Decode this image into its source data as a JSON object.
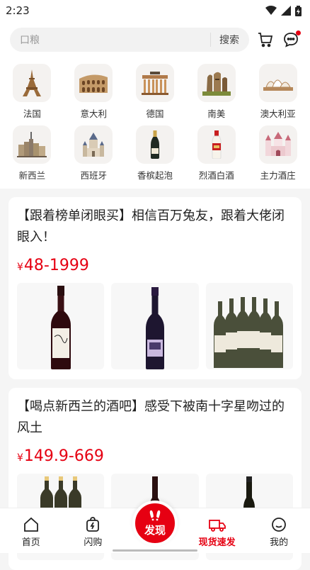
{
  "status": {
    "time": "2:23"
  },
  "search": {
    "placeholder": "口粮",
    "button": "搜索"
  },
  "categories": [
    {
      "label": "法国",
      "icon": "eiffel-tower-icon"
    },
    {
      "label": "意大利",
      "icon": "colosseum-icon"
    },
    {
      "label": "德国",
      "icon": "brandenburg-gate-icon"
    },
    {
      "label": "南美",
      "icon": "moai-icon"
    },
    {
      "label": "澳大利亚",
      "icon": "opera-house-icon"
    },
    {
      "label": "新西兰",
      "icon": "city-skyline-icon"
    },
    {
      "label": "西班牙",
      "icon": "cathedral-icon"
    },
    {
      "label": "香槟起泡",
      "icon": "champagne-bottle-icon"
    },
    {
      "label": "烈酒白酒",
      "icon": "baijiu-bottle-icon"
    },
    {
      "label": "主力酒庄",
      "icon": "castle-icon"
    }
  ],
  "cards": [
    {
      "title": "【跟着榜单闭眼买】相信百万兔友，跟着大佬闭眼入！",
      "currency": "¥",
      "price": "48-1999"
    },
    {
      "title": "【喝点新西兰的酒吧】感受下被南十字星吻过的风土",
      "currency": "¥",
      "price": "149.9-669"
    }
  ],
  "tabs": {
    "home": "首页",
    "flash": "闪购",
    "discover": "发现",
    "express": "现货速发",
    "mine": "我的"
  },
  "colors": {
    "accent": "#e60012"
  }
}
